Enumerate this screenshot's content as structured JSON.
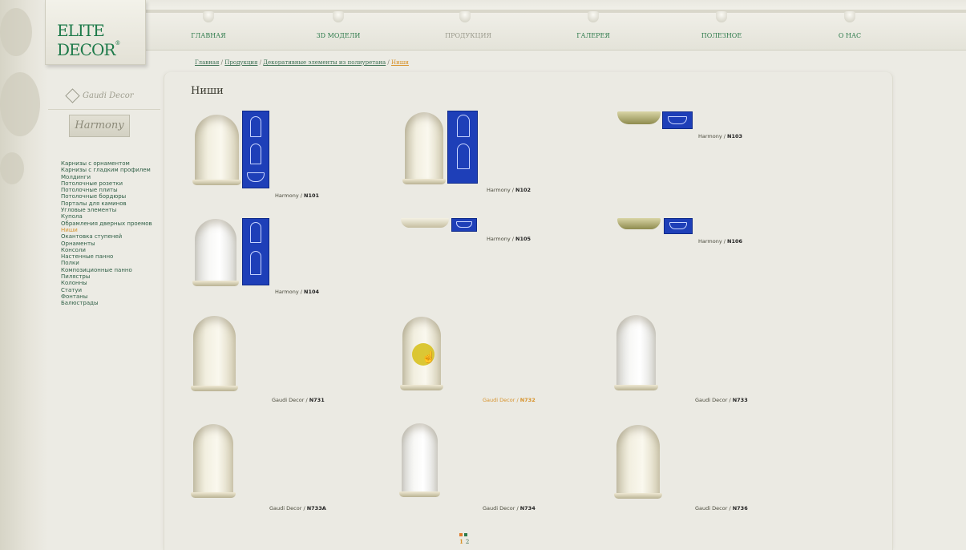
{
  "logo": {
    "text": "ELITE DECOR",
    "mark": "®"
  },
  "nav": [
    {
      "label": "ГЛАВНАЯ"
    },
    {
      "label": "3D МОДЕЛИ"
    },
    {
      "label": "ПРОДУКЦИЯ"
    },
    {
      "label": "ГАЛЕРЕЯ"
    },
    {
      "label": "ПОЛЕЗНОЕ"
    },
    {
      "label": "О НАС"
    }
  ],
  "breadcrumb": [
    "Главная",
    "Продукция",
    "Декоративные элементы из полиуретана",
    "Ниши"
  ],
  "brands": {
    "gaudi": "Gaudi Decor",
    "harmony": "Harmony"
  },
  "page_title": "Ниши",
  "sidebar": {
    "items": [
      "Карнизы с орнаментом",
      "Карнизы с гладким профилем",
      "Молдинги",
      "Потолочные розетки",
      "Потолочные плиты",
      "Потолочные бордюры",
      "Порталы для каминов",
      "Угловые элементы",
      "Купола",
      "Обрамления дверных проемов",
      "Ниши",
      "Окантовка ступеней",
      "Орнаменты",
      "Консоли",
      "Настенные панно",
      "Полки",
      "Композиционные панно",
      "Пилястры",
      "Колонны",
      "Статуи",
      "Фонтаны",
      "Балюстрады"
    ],
    "active_index": 10
  },
  "products": [
    {
      "brand": "Harmony",
      "code": "N101"
    },
    {
      "brand": "Harmony",
      "code": "N102"
    },
    {
      "brand": "Harmony",
      "code": "N103"
    },
    {
      "brand": "Harmony",
      "code": "N104"
    },
    {
      "brand": "Harmony",
      "code": "N105"
    },
    {
      "brand": "Harmony",
      "code": "N106"
    },
    {
      "brand": "Gaudi Decor",
      "code": "N731"
    },
    {
      "brand": "Gaudi Decor",
      "code": "N732"
    },
    {
      "brand": "Gaudi Decor",
      "code": "N733"
    },
    {
      "brand": "Gaudi Decor",
      "code": "N733A"
    },
    {
      "brand": "Gaudi Decor",
      "code": "N734"
    },
    {
      "brand": "Gaudi Decor",
      "code": "N736"
    }
  ],
  "separator": " / ",
  "pager": {
    "pages": [
      "1",
      "2"
    ]
  },
  "colors": {
    "accent": "#d7922a",
    "link": "#2f5f46",
    "drawing": "#1e3fb8"
  }
}
